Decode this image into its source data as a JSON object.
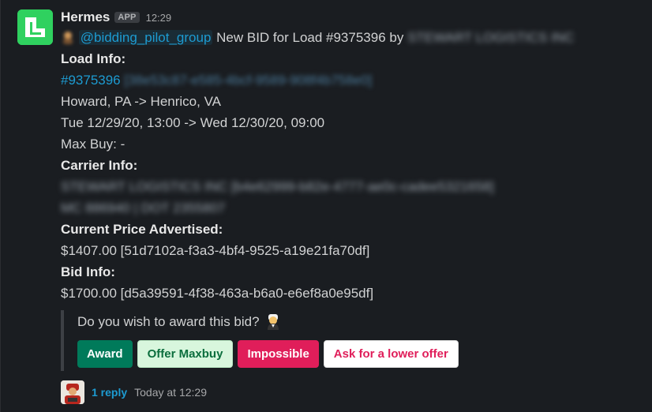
{
  "message": {
    "sender": "Hermes",
    "badge": "APP",
    "time": "12:29",
    "mention": "@bidding_pilot_group",
    "intro": " New BID for Load #9375396 by ",
    "intro_blur": "STEWART LOGISTICS INC",
    "load_info_label": "Load Info:",
    "load_link": "#9375396",
    "load_link_blur": "[38e53c87-e585-4bcf-9589-908f4b758e0]",
    "route": "Howard, PA -> Henrico, VA",
    "dates": "Tue 12/29/20, 13:00 -> Wed 12/30/20, 09:00",
    "max_buy": "Max Buy: -",
    "carrier_info_label": "Carrier Info:",
    "carrier_blur_1": "STEWART LOGISTICS INC [b4e62999-b82e-4777-ae0c-cadee5321658]",
    "carrier_blur_2": "MC 886940 | DOT 2355807",
    "current_price_label": "Current Price Advertised:",
    "current_price": "$1407.00 [51d7102a-f3a3-4bf4-9525-a19e21fa70df]",
    "bid_info_label": "Bid Info:",
    "bid_price": "$1700.00 [d5a39591-4f38-463a-b6a0-e6ef8a0e95df]"
  },
  "attachment": {
    "question": "Do you wish to award this bid?",
    "buttons": {
      "award": "Award",
      "offer_maxbuy": "Offer Maxbuy",
      "impossible": "Impossible",
      "ask_lower": "Ask for a lower offer"
    }
  },
  "thread": {
    "reply_count": "1 reply",
    "reply_time": "Today at 12:29"
  },
  "icons": {
    "app_avatar": "hermes-logo-icon",
    "emoji_inline": "person-emoji-icon",
    "emoji_question": "man-judge-emoji-icon",
    "reply_avatar": "user-avatar-icon"
  },
  "colors": {
    "background": "#1a1d21",
    "link": "#1d9bd1",
    "award": "#007a5a",
    "impossible": "#e01e5a",
    "avatar": "#2fd15f"
  }
}
